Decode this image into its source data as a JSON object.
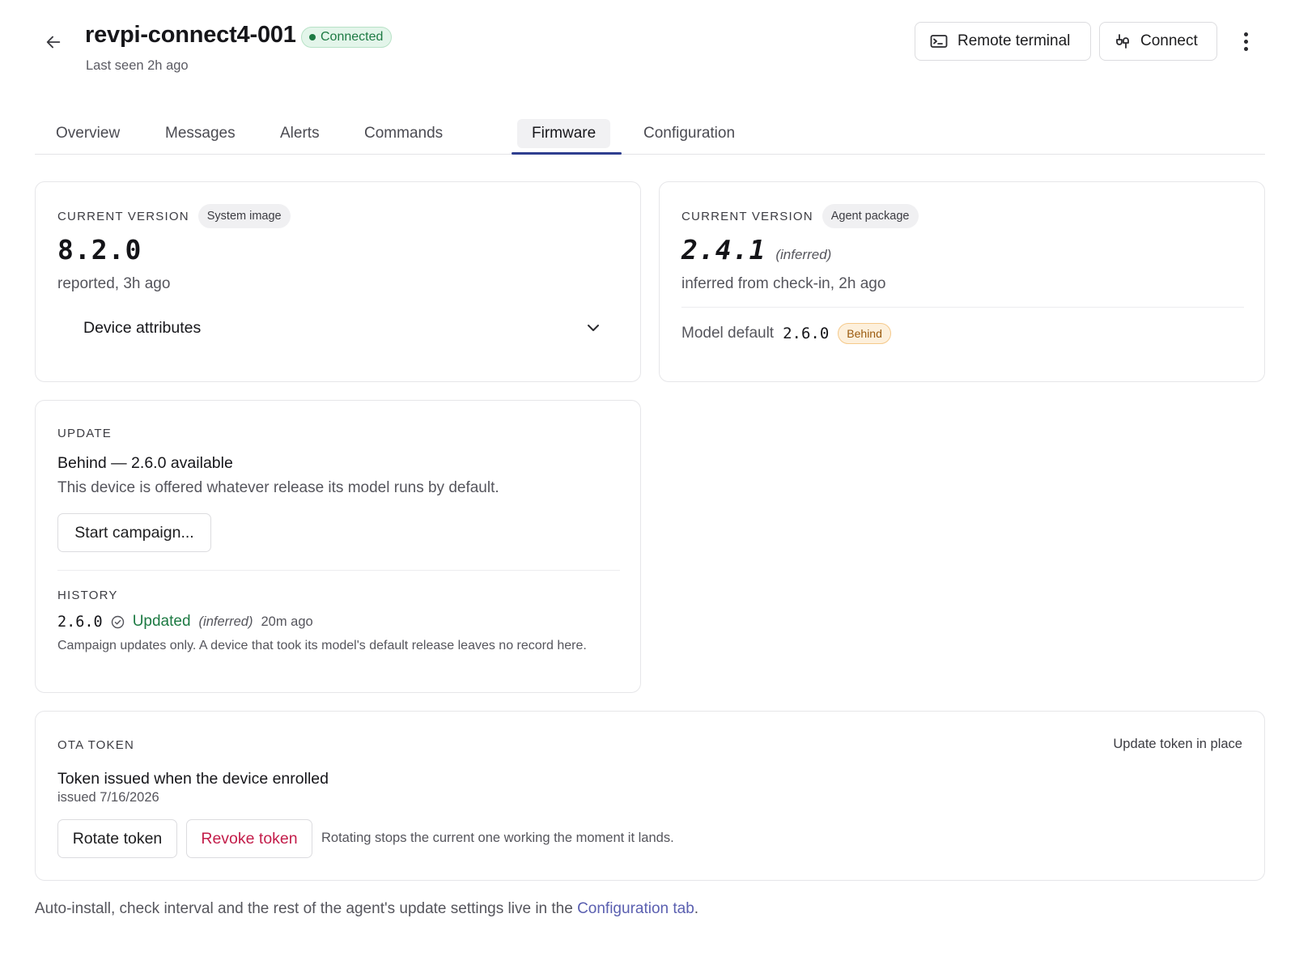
{
  "header": {
    "title": "revpi-connect4-001",
    "status": "Connected",
    "last_seen": "Last seen 2h ago",
    "remote_terminal_label": "Remote terminal",
    "connect_label": "Connect"
  },
  "tabs": [
    {
      "label": "Overview"
    },
    {
      "label": "Messages"
    },
    {
      "label": "Alerts"
    },
    {
      "label": "Commands"
    },
    {
      "label": "Firmware",
      "active": true
    },
    {
      "label": "Configuration"
    }
  ],
  "system_image": {
    "label": "CURRENT VERSION",
    "chip": "System image",
    "version": "8.2.0",
    "reported": "reported, 3h ago",
    "accordion_label": "Device attributes"
  },
  "agent_package": {
    "label": "CURRENT VERSION",
    "chip": "Agent package",
    "version": "2.4.1",
    "inferred_tag": "(inferred)",
    "inferred_from": "inferred from check-in, 2h ago",
    "model_default_label": "Model default",
    "model_default_version": "2.6.0",
    "behind_badge": "Behind"
  },
  "update": {
    "label": "UPDATE",
    "headline": "Behind — 2.6.0 available",
    "description": "This device is offered whatever release its model runs by default.",
    "start_campaign_label": "Start campaign..."
  },
  "history": {
    "label": "HISTORY",
    "version": "2.6.0",
    "status": "Updated",
    "inferred_tag": "(inferred)",
    "time": "20m ago",
    "note": "Campaign updates only. A device that took its model's default release leaves no record here."
  },
  "ota_token": {
    "label": "OTA TOKEN",
    "update_in_place": "Update token in place",
    "title": "Token issued when the device enrolled",
    "issued": "issued 7/16/2026",
    "rotate_label": "Rotate token",
    "revoke_label": "Revoke token",
    "hint": "Rotating stops the current one working the moment it lands."
  },
  "footer": {
    "text": "Auto-install, check interval and the rest of the agent's update settings live in the ",
    "link": "Configuration tab",
    "suffix": "."
  },
  "colors": {
    "accent": "#2f3e8f",
    "connected": "#1d7a43",
    "updated": "#1d7a43",
    "danger": "#c31d4a",
    "behind": "#9a5a0e",
    "link": "#5a5fb0"
  }
}
